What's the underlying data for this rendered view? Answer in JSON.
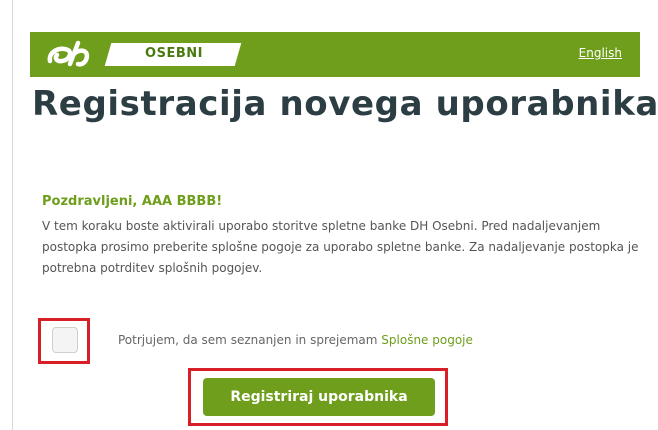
{
  "header": {
    "brand_label": "OSEBNI",
    "language_link": "English",
    "bar_color": "#6e9e1b",
    "logo_icon": "dh-logo-icon"
  },
  "page": {
    "title": "Registracija novega uporabnika"
  },
  "content": {
    "greeting": "Pozdravljeni, AAA BBBB!",
    "intro": "V tem koraku boste aktivirali uporabo storitve spletne banke DH Osebni. Pred nadaljevanjem postopka prosimo preberite splošne pogoje za uporabo spletne banke. Za nadaljevanje postopka je potrebna potrditev splošnih pogojev."
  },
  "consent": {
    "checked": false,
    "label": "Potrjujem, da sem seznanjen in sprejemam",
    "terms_link": "Splošne pogoje"
  },
  "actions": {
    "register_label": "Registriraj uporabnika"
  },
  "colors": {
    "accent": "#6e9e1b",
    "highlight": "#d81e26",
    "title": "#2c3e43"
  }
}
